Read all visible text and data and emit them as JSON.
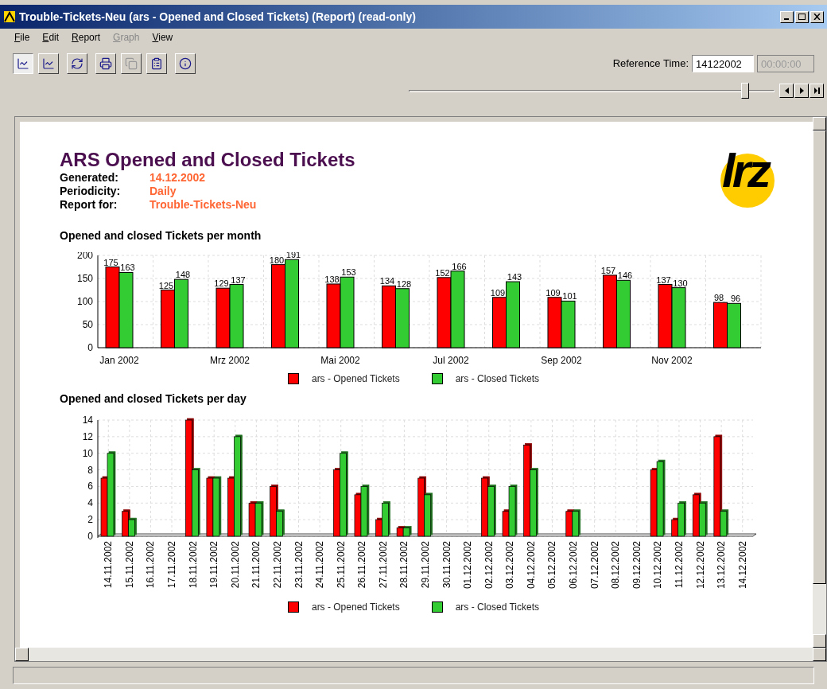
{
  "window": {
    "title": "Trouble-Tickets-Neu (ars - Opened and Closed Tickets) (Report) (read-only)"
  },
  "menu": [
    {
      "label": "File",
      "disabled": false
    },
    {
      "label": "Edit",
      "disabled": false
    },
    {
      "label": "Report",
      "disabled": false
    },
    {
      "label": "Graph",
      "disabled": true
    },
    {
      "label": "View",
      "disabled": false
    }
  ],
  "toolbar": [
    {
      "kind": "chart-pause",
      "selected": true,
      "disabled": false
    },
    {
      "kind": "chart-play",
      "selected": false,
      "disabled": false
    },
    {
      "kind": "refresh",
      "selected": false,
      "disabled": false
    },
    {
      "kind": "print",
      "selected": false,
      "disabled": false
    },
    {
      "kind": "copy",
      "selected": false,
      "disabled": true
    },
    {
      "kind": "properties",
      "selected": false,
      "disabled": false
    },
    {
      "kind": "info",
      "selected": false,
      "disabled": false
    }
  ],
  "reference_time": {
    "label": "Reference Time:",
    "date": "14122002",
    "time": "00:00:00",
    "time_disabled": true
  },
  "time_slider": {
    "level": 0.92
  },
  "report": {
    "title": "ARS Opened and Closed Tickets",
    "logo_text": "lrz",
    "fields": [
      {
        "label": "Generated:",
        "value": "14.12.2002"
      },
      {
        "label": "Periodicity:",
        "value": "Daily"
      },
      {
        "label": "Report for:",
        "value": "Trouble-Tickets-Neu"
      }
    ],
    "sections": [
      {
        "title": "Opened and closed Tickets per month",
        "chart_data": {
          "type": "bar",
          "categories": [
            "Jan 2002",
            null,
            "Mrz 2002",
            null,
            "Mai 2002",
            null,
            "Jul 2002",
            null,
            "Sep 2002",
            null,
            "Nov 2002",
            null
          ],
          "ylim": [
            0,
            200
          ],
          "yticks": [
            0,
            50,
            100,
            150,
            200
          ],
          "data_labels": true,
          "grid": true,
          "legend": "bottom",
          "series": [
            {
              "name": "ars - Opened Tickets",
              "color": "#ff0000",
              "values": [
                175,
                125,
                129,
                180,
                138,
                134,
                152,
                109,
                109,
                157,
                137,
                98
              ]
            },
            {
              "name": "ars - Closed Tickets",
              "color": "#33cc33",
              "values": [
                163,
                148,
                137,
                191,
                153,
                128,
                166,
                143,
                101,
                146,
                130,
                96
              ]
            }
          ]
        }
      },
      {
        "title": "Opened and closed Tickets per day",
        "chart_data": {
          "type": "bar",
          "categories": [
            "14.11.2002",
            "15.11.2002",
            "16.11.2002",
            "17.11.2002",
            "18.11.2002",
            "19.11.2002",
            "20.11.2002",
            "21.11.2002",
            "22.11.2002",
            "23.11.2002",
            "24.11.2002",
            "25.11.2002",
            "26.11.2002",
            "27.11.2002",
            "28.11.2002",
            "29.11.2002",
            "30.11.2002",
            "01.12.2002",
            "02.12.2002",
            "03.12.2002",
            "04.12.2002",
            "05.12.2002",
            "06.12.2002",
            "07.12.2002",
            "08.12.2002",
            "09.12.2002",
            "10.12.2002",
            "11.12.2002",
            "12.12.2002",
            "13.12.2002",
            "14.12.2002"
          ],
          "ylim": [
            0,
            14
          ],
          "yticks": [
            0,
            2,
            4,
            6,
            8,
            10,
            12,
            14
          ],
          "grid": true,
          "legend": "bottom",
          "series": [
            {
              "name": "ars - Opened Tickets",
              "color": "#ff0000",
              "values": [
                7,
                3,
                0,
                0,
                14,
                7,
                7,
                4,
                6,
                0,
                0,
                8,
                5,
                2,
                1,
                7,
                0,
                0,
                7,
                3,
                11,
                null,
                3,
                0,
                0,
                null,
                8,
                2,
                5,
                12,
                0
              ]
            },
            {
              "name": "ars - Closed Tickets",
              "color": "#33cc33",
              "values": [
                10,
                2,
                0,
                0,
                8,
                7,
                12,
                4,
                3,
                0,
                0,
                10,
                6,
                4,
                1,
                5,
                0,
                0,
                6,
                6,
                8,
                null,
                3,
                0,
                0,
                null,
                9,
                4,
                4,
                3,
                0
              ]
            }
          ]
        }
      }
    ]
  }
}
